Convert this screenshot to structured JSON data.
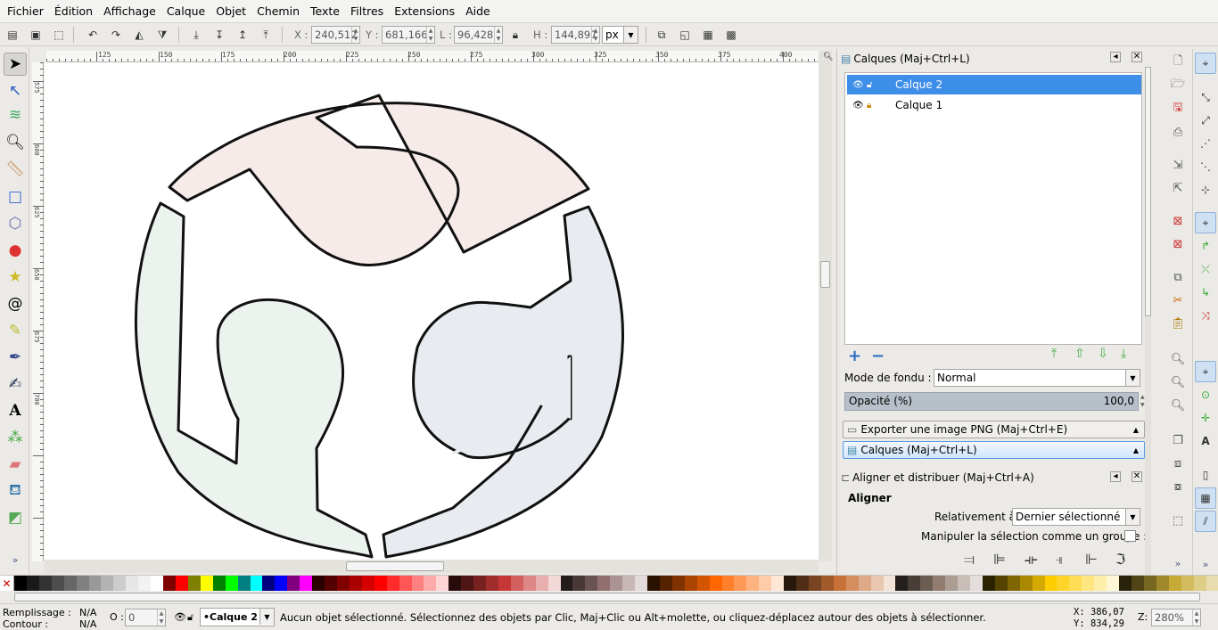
{
  "menu": [
    "Fichier",
    "Édition",
    "Affichage",
    "Calque",
    "Objet",
    "Chemin",
    "Texte",
    "Filtres",
    "Extensions",
    "Aide"
  ],
  "toolbar": {
    "x_label": "X :",
    "x_value": "240,512",
    "y_label": "Y :",
    "y_value": "681,166",
    "w_label": "L :",
    "w_value": "96,428",
    "h_label": "H :",
    "h_value": "144,897",
    "unit": "px"
  },
  "tools": [
    "selector-tool",
    "node-tool",
    "tweak-tool",
    "zoom-tool",
    "measure-tool",
    "rect-tool",
    "3dbox-tool",
    "ellipse-tool",
    "star-tool",
    "spiral-tool",
    "pencil-tool",
    "pen-tool",
    "calligraphy-tool",
    "text-tool",
    "spray-tool",
    "eraser-tool",
    "paint-bucket-tool",
    "gradient-tool"
  ],
  "ruler": {
    "top_ticks": [
      "125",
      "150",
      "175",
      "200",
      "225",
      "250",
      "275",
      "300",
      "325",
      "350",
      "375",
      "400"
    ],
    "left_ticks": [
      "575",
      "600",
      "625",
      "650",
      "675",
      "700"
    ]
  },
  "panel": {
    "title": "Calques (Maj+Ctrl+L)",
    "layers": [
      {
        "name": "Calque 2",
        "selected": true
      },
      {
        "name": "Calque 1",
        "selected": false
      }
    ],
    "blend_label": "Mode de fondu :",
    "blend_value": "Normal",
    "opacity_label": "Opacité (%)",
    "opacity_value": "100,0",
    "export_label": "Exporter une image PNG (Maj+Ctrl+E)",
    "layers_tab_label": "Calques (Maj+Ctrl+L)",
    "align_title": "Aligner et distribuer (Maj+Ctrl+A)",
    "align_heading": "Aligner",
    "relative_label": "Relativement à :",
    "relative_value": "Dernier sélectionné",
    "group_label": "Manipuler la sélection comme un groupe :"
  },
  "colors": {
    "palette": [
      "#000000",
      "#1a1a1a",
      "#333333",
      "#4d4d4d",
      "#666666",
      "#808080",
      "#999999",
      "#b3b3b3",
      "#cccccc",
      "#e6e6e6",
      "#f2f2f2",
      "#ffffff",
      "#800000",
      "#ff0000",
      "#808000",
      "#ffff00",
      "#008000",
      "#00ff00",
      "#008080",
      "#00ffff",
      "#000080",
      "#0000ff",
      "#800080",
      "#ff00ff",
      "#2b0000",
      "#550000",
      "#800000",
      "#aa0000",
      "#d40000",
      "#ff0000",
      "#ff2a2a",
      "#ff5555",
      "#ff8080",
      "#ffaaaa",
      "#ffd5d5",
      "#280b0b",
      "#501616",
      "#782121",
      "#a02c2c",
      "#c83737",
      "#d35f5f",
      "#de8787",
      "#e9afaf",
      "#f4d7d7",
      "#241c1c",
      "#483737",
      "#6c5353",
      "#916f6f",
      "#ac9393",
      "#c8b7b7",
      "#e3dbdb",
      "#2b1100",
      "#552200",
      "#803300",
      "#aa4400",
      "#d45500",
      "#ff6600",
      "#ff7f2a",
      "#ff9955",
      "#ffb380",
      "#ffccaa",
      "#ffe6d5",
      "#28170b",
      "#502d16",
      "#784421",
      "#a05a2c",
      "#c87137",
      "#d38d5f",
      "#deaa87",
      "#e9c6af",
      "#f4e3d7",
      "#241f1c",
      "#483e37",
      "#6c5d53",
      "#917c6f",
      "#ac9d93",
      "#c8beb7",
      "#e3dedb",
      "#2b2200",
      "#554400",
      "#806600",
      "#aa8800",
      "#d4aa00",
      "#ffcc00",
      "#ffd42a",
      "#ffdd55",
      "#ffe680",
      "#ffeeaa",
      "#fff6d5",
      "#28220b",
      "#504416",
      "#786721",
      "#a0892c",
      "#c8ab37",
      "#d3bc5f",
      "#decd87",
      "#e9ddaf"
    ],
    "shape_pink": "#f7ebea",
    "shape_green": "#ecf2ee",
    "shape_blue": "#e8ecf1"
  },
  "status": {
    "fill_label": "Remplissage :",
    "fill_value": "N/A",
    "stroke_label": "Contour :",
    "stroke_value": "N/A",
    "opacity_label": "O :",
    "opacity_value": "0",
    "layer_value": "•Calque 2",
    "message": "Aucun objet sélectionné. Sélectionnez des objets par Clic, Maj+Clic ou Alt+molette, ou cliquez-déplacez autour des objets à sélectionner.",
    "cursor_x": "X:  386,07",
    "cursor_y": "Y:  834,29",
    "zoom_label": "Z:",
    "zoom_value": "280%"
  }
}
